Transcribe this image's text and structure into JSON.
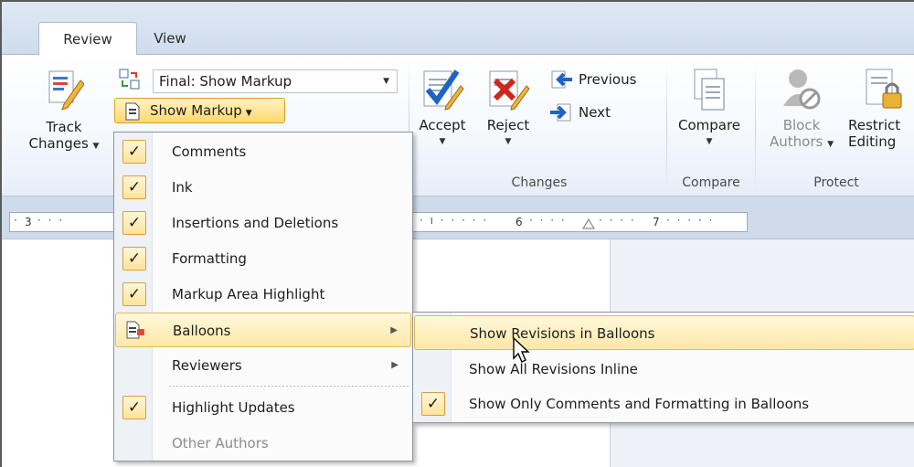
{
  "tabs": {
    "review": "Review",
    "view": "View"
  },
  "tracking": {
    "track_changes_line1": "Track",
    "track_changes_line2": "Changes",
    "display_for_review": "Final: Show Markup",
    "show_markup": "Show Markup"
  },
  "changes": {
    "accept": "Accept",
    "reject": "Reject",
    "previous": "Previous",
    "next": "Next",
    "group_label": "Changes"
  },
  "compare": {
    "compare": "Compare",
    "group_label": "Compare"
  },
  "protect": {
    "block_line1": "Block",
    "block_line2": "Authors",
    "restrict_line1": "Restrict",
    "restrict_line2": "Editing",
    "group_label": "Protect"
  },
  "ruler": {
    "left_num": "3",
    "mid_num": "6",
    "right_num": "7"
  },
  "show_markup_menu": [
    {
      "label": "Comments",
      "checked": true
    },
    {
      "label": "Ink",
      "checked": true
    },
    {
      "label": "Insertions and Deletions",
      "checked": true
    },
    {
      "label": "Formatting",
      "checked": true
    },
    {
      "label": "Markup Area Highlight",
      "checked": true
    },
    {
      "label": "Balloons",
      "checked": false,
      "submenu": true
    },
    {
      "label": "Reviewers",
      "checked": false,
      "submenu": true
    },
    {
      "label": "Highlight Updates",
      "checked": true
    },
    {
      "label": "Other Authors",
      "checked": false,
      "disabled": true
    }
  ],
  "balloons_menu": [
    {
      "label": "Show Revisions in Balloons",
      "checked": false
    },
    {
      "label": "Show All Revisions Inline",
      "checked": false
    },
    {
      "label": "Show Only Comments and Formatting in Balloons",
      "checked": true
    }
  ],
  "colors": {
    "accent": "#ffe39b",
    "hover_border": "#e4b95b",
    "ribbon_blue": "#cfdcec"
  }
}
